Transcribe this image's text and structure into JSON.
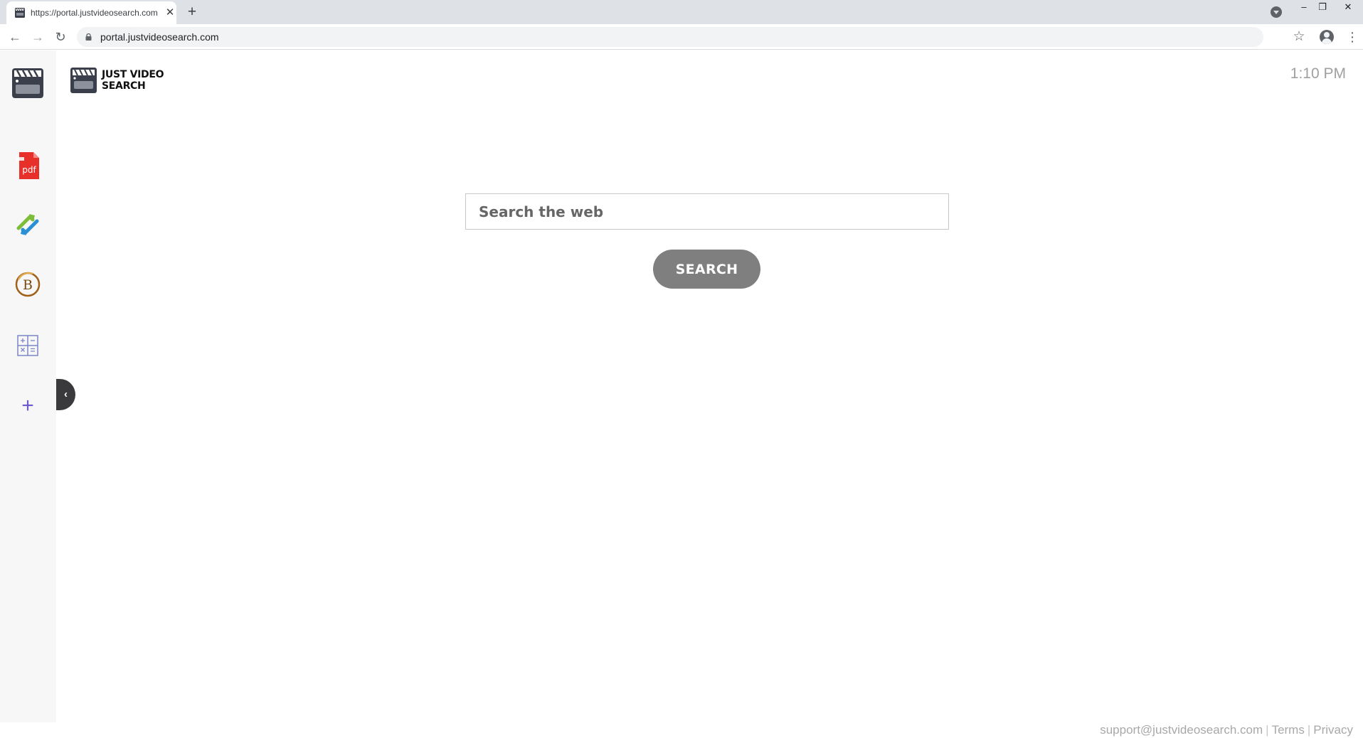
{
  "browser": {
    "tab_title": "https://portal.justvideosearch.com",
    "tab_close": "✕",
    "new_tab": "+",
    "url": "portal.justvideosearch.com",
    "window_minimize": "–",
    "window_restore": "❐",
    "window_close": "✕",
    "back": "←",
    "forward": "→",
    "reload": "↻",
    "bookmark": "☆",
    "menu": "⋮"
  },
  "sidebar": {
    "items": [
      {
        "icon": "clapperboard-icon"
      },
      {
        "icon": "pdf-icon",
        "text": "pdf"
      },
      {
        "icon": "convert-arrows-icon"
      },
      {
        "icon": "bitcoin-b-icon",
        "text": "B"
      },
      {
        "icon": "calculator-grid-icon"
      },
      {
        "icon": "plus-icon",
        "text": "+"
      }
    ],
    "collapse": "‹"
  },
  "header": {
    "logo_line1": "Just Video",
    "logo_line2": "Search",
    "clock": "1:10 PM"
  },
  "search": {
    "placeholder": "Search the web",
    "button_label": "SEARCH",
    "button_color": "#7f7f7f"
  },
  "footer": {
    "email": "support@justvideosearch.com",
    "terms": "Terms",
    "privacy": "Privacy"
  },
  "colors": {
    "pdf_red": "#e8302a",
    "plus_purple": "#6a5acd",
    "calc_blue": "#7b86c9"
  }
}
